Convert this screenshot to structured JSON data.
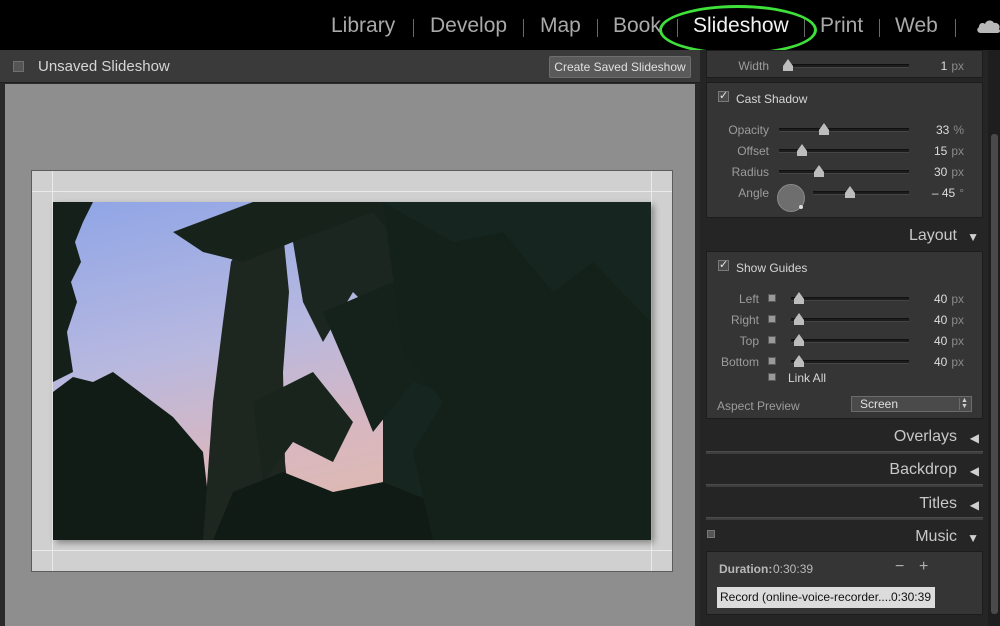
{
  "modules": {
    "library": "Library",
    "develop": "Develop",
    "map": "Map",
    "book": "Book",
    "slideshow": "Slideshow",
    "print": "Print",
    "web": "Web"
  },
  "slideshow": {
    "title": "Unsaved Slideshow",
    "create_button": "Create Saved Slideshow"
  },
  "options": {
    "stroke_width": {
      "label": "Width",
      "value": "1",
      "unit": "px"
    },
    "cast_shadow": {
      "label": "Cast Shadow",
      "checked": true,
      "opacity": {
        "label": "Opacity",
        "value": "33",
        "unit": "%"
      },
      "offset": {
        "label": "Offset",
        "value": "15",
        "unit": "px"
      },
      "radius": {
        "label": "Radius",
        "value": "30",
        "unit": "px"
      },
      "angle": {
        "label": "Angle",
        "value": "– 45",
        "unit": "°"
      }
    }
  },
  "layout": {
    "title": "Layout",
    "show_guides": {
      "label": "Show Guides",
      "checked": true
    },
    "left": {
      "label": "Left",
      "value": "40",
      "unit": "px"
    },
    "right": {
      "label": "Right",
      "value": "40",
      "unit": "px"
    },
    "top": {
      "label": "Top",
      "value": "40",
      "unit": "px"
    },
    "bottom": {
      "label": "Bottom",
      "value": "40",
      "unit": "px"
    },
    "link_all": "Link All",
    "aspect_preview": {
      "label": "Aspect Preview",
      "value": "Screen"
    }
  },
  "sections": {
    "overlays": "Overlays",
    "backdrop": "Backdrop",
    "titles": "Titles",
    "music": "Music"
  },
  "music": {
    "duration_label": "Duration:",
    "duration_value": "0:30:39",
    "minus": "−",
    "plus": "+",
    "track_name": "Record (online-voice-recorder....",
    "track_duration": "0:30:39"
  },
  "icons": {
    "cloud": "cloud-icon",
    "collapse": "triangle-left-icon",
    "expand": "triangle-down-icon",
    "dropdown": "updown-arrows-icon"
  },
  "colors": {
    "highlight": "#3fe03a",
    "panel": "#353535",
    "canvas": "#8e8e8e"
  }
}
